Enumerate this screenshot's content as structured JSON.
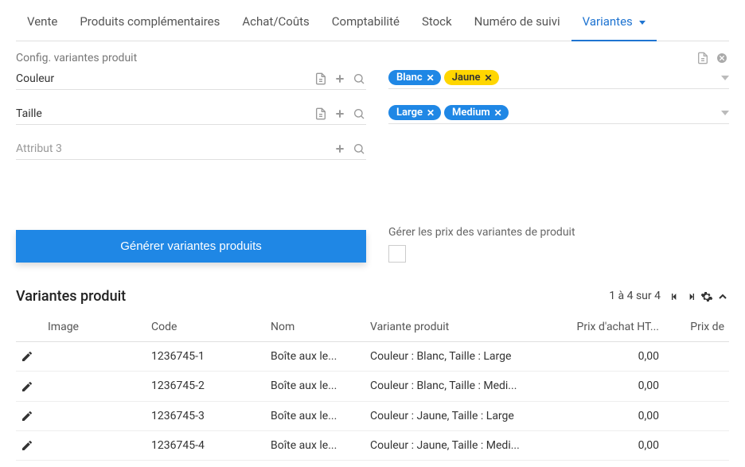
{
  "tabs": {
    "vente": "Vente",
    "complements": "Produits complémentaires",
    "achat": "Achat/Coûts",
    "compta": "Comptabilité",
    "stock": "Stock",
    "suivi": "Numéro de suivi",
    "variantes": "Variantes"
  },
  "config": {
    "section_label": "Config. variantes produit",
    "attrs": {
      "couleur": {
        "label": "Couleur",
        "tags": [
          "Blanc",
          "Jaune"
        ]
      },
      "taille": {
        "label": "Taille",
        "tags": [
          "Large",
          "Medium"
        ]
      },
      "attr3_placeholder": "Attribut 3"
    }
  },
  "actions": {
    "generate": "Générer variantes produits",
    "manage_prices_label": "Gérer les prix des variantes de produit"
  },
  "variants": {
    "title": "Variantes produit",
    "pager": "1 à 4 sur 4",
    "columns": {
      "image": "Image",
      "code": "Code",
      "nom": "Nom",
      "variant": "Variante produit",
      "prix_achat": "Prix d'achat HT...",
      "prix_de": "Prix de"
    },
    "rows": [
      {
        "code": "1236745-1",
        "nom": "Boîte aux le...",
        "variant": "Couleur : Blanc, Taille : Large",
        "prix": "0,00"
      },
      {
        "code": "1236745-2",
        "nom": "Boîte aux le...",
        "variant": "Couleur : Blanc, Taille : Medi...",
        "prix": "0,00"
      },
      {
        "code": "1236745-3",
        "nom": "Boîte aux le...",
        "variant": "Couleur : Jaune, Taille : Large",
        "prix": "0,00"
      },
      {
        "code": "1236745-4",
        "nom": "Boîte aux le...",
        "variant": "Couleur : Jaune, Taille : Medi...",
        "prix": "0,00"
      }
    ]
  }
}
